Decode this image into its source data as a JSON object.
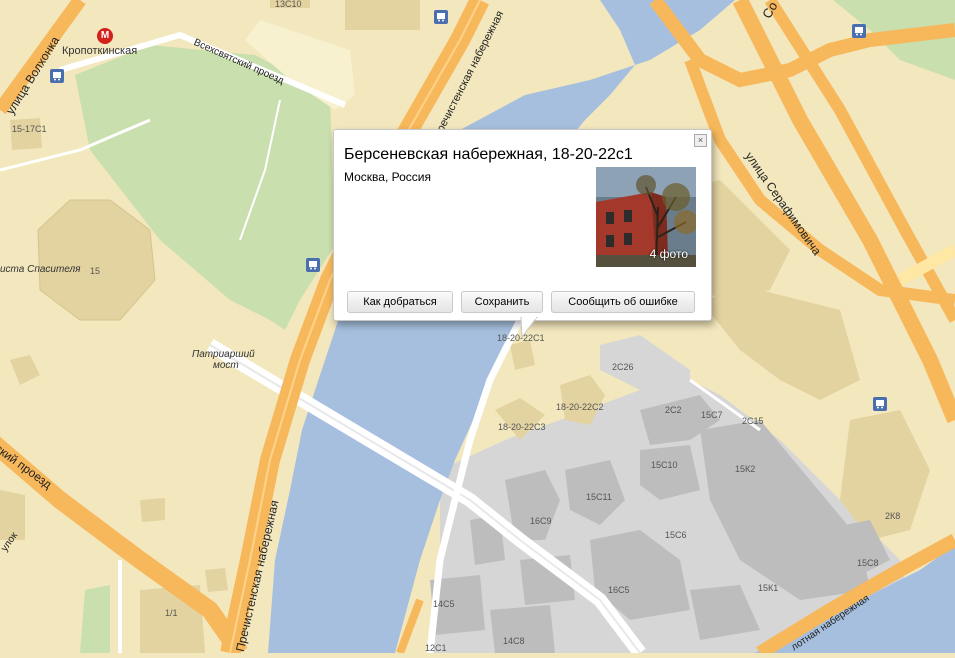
{
  "map": {
    "metro_station": "Кропоткинская",
    "metro_symbol": "М",
    "streets": {
      "volkhonka": "улица Волхонка",
      "vsekhsvyatsky": "Всехсвятский проезд",
      "prechistenskaya_top": "Пречистенская набережная",
      "prechistenskaya_bottom": "Пречистенская набережная",
      "serafimovicha": "улица Серафимовича",
      "so_top": "Со",
      "proezd_left": "ский проезд",
      "ulok": "улок",
      "bolotnaya": "лотная набережная"
    },
    "bridge_label_1": "Патриарший",
    "bridge_label_2": "мост",
    "cathedral_label": "иста Спасителя",
    "building_labels": {
      "b13c10": "13С10",
      "b15_17c1": "15-17С1",
      "b15": "15",
      "b18_20_22c1": "18-20-22С1",
      "b2c26": "2С26",
      "b18_20_22c2": "18-20-22С2",
      "b18_20_22c3": "18-20-22С3",
      "b2c2": "2С2",
      "b15c7": "15С7",
      "b2c15": "2С15",
      "b15c10": "15С10",
      "b15k2": "15К2",
      "b15c11": "15С11",
      "b16c9": "16С9",
      "b15c6": "15С6",
      "b2k8": "2К8",
      "b15c8": "15С8",
      "b16c5": "16С5",
      "b15k1": "15К1",
      "b14c5": "14С5",
      "b14c8": "14С8",
      "b12c1": "12С1",
      "b1_1": "1/1"
    }
  },
  "popup": {
    "title": "Берсеневская набережная, 18-20-22с1",
    "subtitle": "Москва, Россия",
    "close_symbol": "×",
    "photo_count": "4 фото",
    "buttons": {
      "route": "Как добраться",
      "save": "Сохранить",
      "report": "Сообщить об ошибке"
    }
  },
  "colors": {
    "land": "#f3e7bd",
    "water": "#a6bfde",
    "park": "#c9dfae",
    "industrial": "#d6d6d6",
    "building": "#e3d3a1",
    "major_road": "#f7b85b",
    "minor_road": "#ffffff",
    "metro": "#d2211b",
    "bus_stop": "#4a6fb0"
  }
}
